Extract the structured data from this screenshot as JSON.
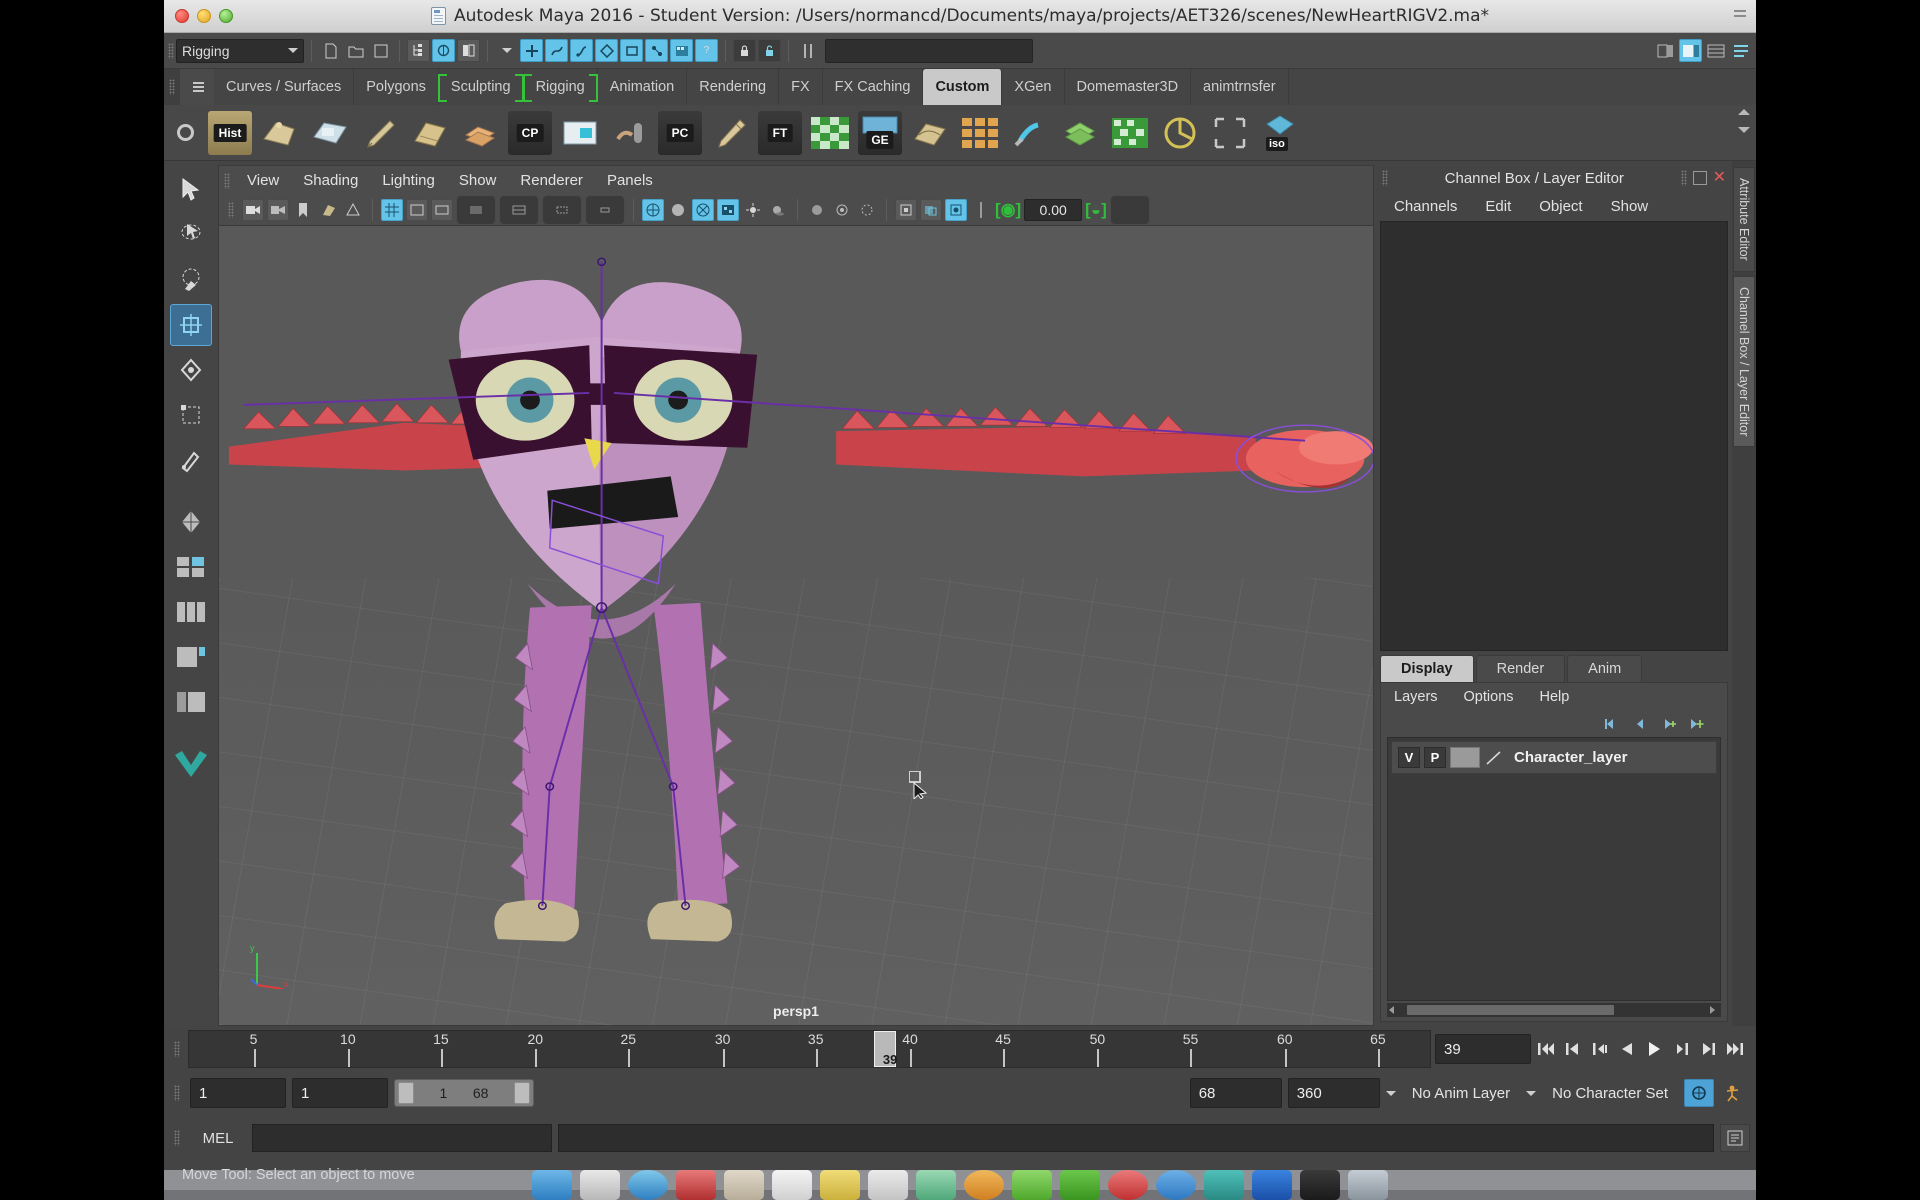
{
  "window": {
    "title": "Autodesk Maya 2016 - Student Version: /Users/normancd/Documents/maya/projects/AET326/scenes/NewHeartRIGV2.ma*",
    "doc_icon": "maya-file-icon",
    "close_label": "",
    "minimize_label": "",
    "zoom_label": ""
  },
  "status_line": {
    "menu_set": "Rigging",
    "icons": [
      "new-scene-icon",
      "open-scene-icon",
      "save-scene-icon",
      "undo-icon",
      "redo-icon",
      "select-hierarchy-icon",
      "select-object-icon",
      "select-component-icon",
      "select-mode-dropdown",
      "snap-to-grid-icon",
      "snap-to-curve-icon",
      "snap-to-point-icon",
      "snap-to-projected-icon",
      "snap-to-view-plane-icon",
      "construction-history-icon",
      "render-sequence-icon",
      "help-icon",
      "lock-icon",
      "unlock-icon",
      "sidebar-toggle-icon",
      "field-input",
      "show-hide-editors-icon",
      "channel-box-toggle-icon",
      "attribute-editor-toggle-icon",
      "tool-settings-toggle-icon"
    ],
    "input_value": ""
  },
  "shelf": {
    "tabs": [
      {
        "label": "Curves / Surfaces",
        "active": false
      },
      {
        "label": "Polygons",
        "active": false
      },
      {
        "label": "Sculpting",
        "active": false,
        "bracket": "both"
      },
      {
        "label": "Rigging",
        "active": false,
        "bracket": "both"
      },
      {
        "label": "Animation",
        "active": false
      },
      {
        "label": "Rendering",
        "active": false
      },
      {
        "label": "FX",
        "active": false
      },
      {
        "label": "FX Caching",
        "active": false
      },
      {
        "label": "Custom",
        "active": true
      },
      {
        "label": "XGen",
        "active": false
      },
      {
        "label": "Domemaster3D",
        "active": false
      },
      {
        "label": "animtrnsfer",
        "active": false
      }
    ],
    "buttons": [
      {
        "name": "hist-shelf-button",
        "label": "Hist",
        "color": "#c9b98a"
      },
      {
        "name": "polygon-shelf-button",
        "label": "",
        "color": "#d8cba3"
      },
      {
        "name": "image-plane-shelf-button",
        "label": "",
        "color": "#c8d9e2"
      },
      {
        "name": "paint-shelf-button",
        "label": "",
        "color": "#cbbb92"
      },
      {
        "name": "book-shelf-button",
        "label": "",
        "color": "#d0bc8d"
      },
      {
        "name": "layers-shelf-button",
        "label": "",
        "color": "#e0b07a"
      },
      {
        "name": "cp-shelf-button",
        "label": "CP",
        "color": "#9fa6ad"
      },
      {
        "name": "render-view-shelf-button",
        "label": "",
        "color": "#6fc4d6"
      },
      {
        "name": "paint-weights-shelf-button",
        "label": "",
        "color": "#c7a786"
      },
      {
        "name": "pc-shelf-button",
        "label": "PC",
        "color": "#9fa6ad"
      },
      {
        "name": "brush-shelf-button",
        "label": "",
        "color": "#cdbf95"
      },
      {
        "name": "ft-shelf-button",
        "label": "FT",
        "color": "#a8b0b6"
      },
      {
        "name": "checker-shelf-button",
        "label": "",
        "color": "#4aa84a"
      },
      {
        "name": "ge-shelf-button",
        "label": "GE",
        "color": "#7eb6d8"
      },
      {
        "name": "graph-shelf-button",
        "label": "",
        "color": "#cbb98e"
      },
      {
        "name": "grid-shelf-button",
        "label": "",
        "color": "#e0a54e"
      },
      {
        "name": "paint-tool-shelf-button",
        "label": "",
        "color": "#7fd0e8"
      },
      {
        "name": "layered-shelf-button",
        "label": "",
        "color": "#8fcf6e"
      },
      {
        "name": "matrix-shelf-button",
        "label": "",
        "color": "#4aa84a"
      },
      {
        "name": "target-shelf-button",
        "label": "",
        "color": "#d3c155"
      },
      {
        "name": "bounding-box-shelf-button",
        "label": "",
        "color": "#b8b8b8"
      },
      {
        "name": "iso-shelf-button",
        "label": "iso",
        "color": "#5fb8d8"
      }
    ]
  },
  "toolbox": {
    "tools": [
      {
        "name": "select-tool",
        "active": false
      },
      {
        "name": "lasso-tool",
        "active": false
      },
      {
        "name": "paint-select-tool",
        "active": false
      },
      {
        "name": "move-tool",
        "active": true
      },
      {
        "name": "rotate-tool",
        "active": false
      },
      {
        "name": "scale-tool",
        "active": false
      },
      {
        "name": "last-tool",
        "active": false
      },
      {
        "name": "four-view-layout",
        "active": false
      },
      {
        "name": "two-pane-layout",
        "active": false
      },
      {
        "name": "three-pane-layout",
        "active": false
      },
      {
        "name": "single-persp-layout",
        "active": false
      },
      {
        "name": "outliner-persp-layout",
        "active": false
      },
      {
        "name": "maya-logo",
        "active": false
      }
    ]
  },
  "viewport": {
    "menus": [
      "View",
      "Shading",
      "Lighting",
      "Show",
      "Renderer",
      "Panels"
    ],
    "camera_label": "persp1",
    "exposure_value": "0.00",
    "toolbar_icons": [
      "select-camera-icon",
      "camera-attributes-icon",
      "bookmark-icon",
      "image-plane-icon",
      "two-sided-lighting-icon",
      "shadows-icon",
      "grid-toggle-icon",
      "film-gate-icon",
      "resolution-gate-icon",
      "gate-mask-icon",
      "wireframe-icon",
      "smooth-shade-icon",
      "textured-icon",
      "use-all-lights-icon",
      "shadow-toggle-icon",
      "ambient-occlusion-icon",
      "motion-blur-icon",
      "isolate-select-icon",
      "xray-icon",
      "xray-joints-icon",
      "exposure-icon",
      "gamma-icon"
    ],
    "axis_labels": {
      "y": "y",
      "x": "x"
    }
  },
  "channel_box": {
    "panel_title": "Channel Box / Layer Editor",
    "menus": [
      "Channels",
      "Edit",
      "Object",
      "Show"
    ],
    "content": ""
  },
  "layer_editor": {
    "tabs": [
      {
        "label": "Display",
        "active": true
      },
      {
        "label": "Render",
        "active": false
      },
      {
        "label": "Anim",
        "active": false
      }
    ],
    "menus": [
      "Layers",
      "Options",
      "Help"
    ],
    "toolbar_icons": [
      "layer-first-icon",
      "layer-prev-icon",
      "layer-new-icon",
      "layer-new-selected-icon"
    ],
    "layers": [
      {
        "visibility": "V",
        "playback": "P",
        "color_swatch": "#9a9a9a",
        "name": "Character_layer"
      }
    ]
  },
  "side_tabs": [
    {
      "label": "Attribute Editor",
      "active": false
    },
    {
      "label": "Channel Box / Layer Editor",
      "active": true
    }
  ],
  "timeline": {
    "ticks": [
      5,
      10,
      15,
      20,
      25,
      30,
      35,
      40,
      45,
      50,
      55,
      60,
      65
    ],
    "range_start": 1,
    "range_end": 68,
    "current_frame": "39",
    "playhead_label": "39",
    "playback_buttons": [
      "go-to-start-icon",
      "step-back-frame-icon",
      "step-back-key-icon",
      "play-backwards-icon",
      "play-forwards-icon",
      "step-forward-key-icon",
      "step-forward-frame-icon",
      "go-to-end-icon"
    ]
  },
  "range_slider": {
    "anim_start": "1",
    "range_start": "1",
    "slider_min": "1",
    "slider_max": "68",
    "range_end": "68",
    "anim_end": "360",
    "anim_layer": "No Anim Layer",
    "character_set": "No Character Set",
    "auto_key_icon": "auto-keyframe-icon",
    "anim_prefs_icon": "animation-preferences-icon"
  },
  "mel": {
    "label": "MEL",
    "input_value": "",
    "output_value": "",
    "script_editor_icon": "script-editor-icon"
  },
  "help_line": {
    "text": "Move Tool: Select an object to move"
  },
  "dock": {
    "items": [
      {
        "name": "finder-dock-icon",
        "color": "#4a90d9"
      },
      {
        "name": "launchpad-dock-icon",
        "color": "#bdbdbd"
      },
      {
        "name": "safari-dock-icon",
        "color": "#3b9ad9"
      },
      {
        "name": "mail-dock-icon",
        "color": "#d14b4b"
      },
      {
        "name": "contacts-dock-icon",
        "color": "#c8c0b0"
      },
      {
        "name": "calendar-dock-icon",
        "color": "#e8e8e8"
      },
      {
        "name": "notes-dock-icon",
        "color": "#e6d06a"
      },
      {
        "name": "reminders-dock-icon",
        "color": "#d8d8d8"
      },
      {
        "name": "maps-dock-icon",
        "color": "#7ec8a0"
      },
      {
        "name": "photos-dock-icon",
        "color": "#e0a040"
      },
      {
        "name": "messages-dock-icon",
        "color": "#6cc04a"
      },
      {
        "name": "facetime-dock-icon",
        "color": "#4ab84a"
      },
      {
        "name": "itunes-dock-icon",
        "color": "#e05a5a"
      },
      {
        "name": "appstore-dock-icon",
        "color": "#4a9ad9"
      },
      {
        "name": "maya-dock-icon",
        "color": "#3aa8a0"
      },
      {
        "name": "photoshop-dock-icon",
        "color": "#2a6fd0"
      },
      {
        "name": "terminal-dock-icon",
        "color": "#2b2b2b"
      },
      {
        "name": "trash-dock-icon",
        "color": "#aab4bc"
      }
    ]
  }
}
